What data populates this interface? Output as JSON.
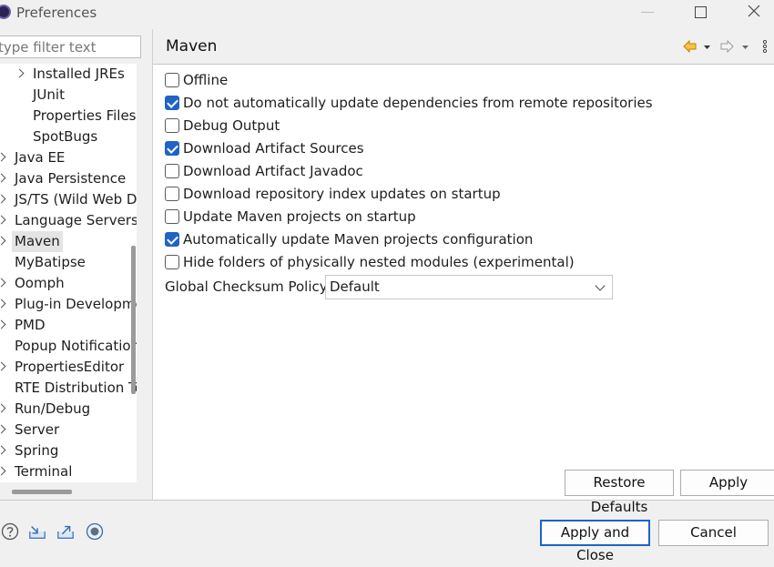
{
  "window": {
    "title": "Preferences"
  },
  "filter": {
    "placeholder": "type filter text"
  },
  "tree": {
    "items": [
      {
        "label": "Installed JREs",
        "expandable": true,
        "indent": 1
      },
      {
        "label": "JUnit",
        "expandable": false,
        "indent": 1
      },
      {
        "label": "Properties Files Editor",
        "expandable": false,
        "indent": 1
      },
      {
        "label": "SpotBugs",
        "expandable": false,
        "indent": 1
      },
      {
        "label": "Java EE",
        "expandable": true,
        "indent": 0
      },
      {
        "label": "Java Persistence",
        "expandable": true,
        "indent": 0
      },
      {
        "label": "JS/TS (Wild Web Developer)",
        "expandable": true,
        "indent": 0
      },
      {
        "label": "Language Servers",
        "expandable": true,
        "indent": 0
      },
      {
        "label": "Maven",
        "expandable": true,
        "indent": 0,
        "selected": true
      },
      {
        "label": "MyBatipse",
        "expandable": false,
        "indent": 0
      },
      {
        "label": "Oomph",
        "expandable": true,
        "indent": 0
      },
      {
        "label": "Plug-in Development",
        "expandable": true,
        "indent": 0
      },
      {
        "label": "PMD",
        "expandable": true,
        "indent": 0
      },
      {
        "label": "Popup Notifications",
        "expandable": false,
        "indent": 0
      },
      {
        "label": "PropertiesEditor",
        "expandable": true,
        "indent": 0
      },
      {
        "label": "RTE Distribution Tool",
        "expandable": false,
        "indent": 0
      },
      {
        "label": "Run/Debug",
        "expandable": true,
        "indent": 0
      },
      {
        "label": "Server",
        "expandable": true,
        "indent": 0
      },
      {
        "label": "Spring",
        "expandable": true,
        "indent": 0
      },
      {
        "label": "Terminal",
        "expandable": true,
        "indent": 0
      }
    ]
  },
  "page": {
    "title": "Maven",
    "options": [
      {
        "label": "Offline",
        "checked": false
      },
      {
        "label": "Do not automatically update dependencies from remote repositories",
        "checked": true
      },
      {
        "label": "Debug Output",
        "checked": false
      },
      {
        "label": "Download Artifact Sources",
        "checked": true
      },
      {
        "label": "Download Artifact Javadoc",
        "checked": false
      },
      {
        "label": "Download repository index updates on startup",
        "checked": false
      },
      {
        "label": "Update Maven projects on startup",
        "checked": false
      },
      {
        "label": "Automatically update Maven projects configuration",
        "checked": true
      },
      {
        "label": "Hide folders of physically nested modules (experimental)",
        "checked": false
      }
    ],
    "checksum_label": "Global Checksum Policy:",
    "checksum_value": "Default"
  },
  "buttons": {
    "restore_defaults": "Restore Defaults",
    "apply": "Apply",
    "apply_and_close": "Apply and Close",
    "cancel": "Cancel"
  },
  "colors": {
    "accent": "#1f63c6",
    "nav_back": "#e8a317"
  },
  "icons": [
    "help-icon",
    "import-icon",
    "export-icon",
    "record-icon"
  ]
}
